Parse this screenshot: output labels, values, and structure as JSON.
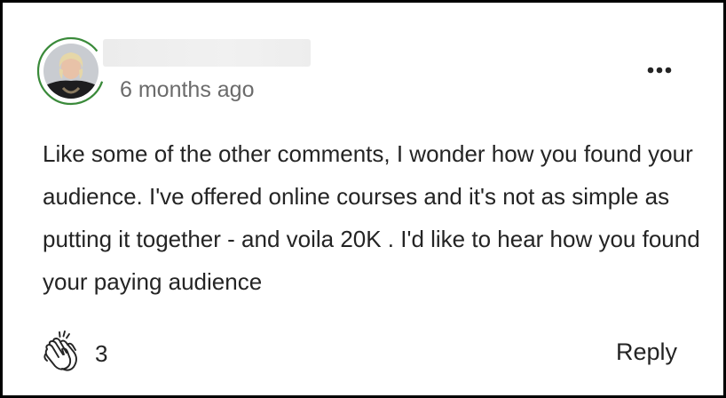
{
  "comment": {
    "author_name": "",
    "timestamp": "6 months ago",
    "body": "Like some of the other comments, I wonder how you found your audience. I've offered online courses and it's not as simple as putting it together - and voila 20K . I'd like to hear how you found your paying audience",
    "clap_count": "3",
    "reply_label": "Reply"
  },
  "icons": {
    "more": "more-horizontal-icon",
    "clap": "clap-icon",
    "avatar": "avatar-photo"
  },
  "colors": {
    "ring": "#3a8a3a",
    "text": "#242424",
    "muted": "#6b6b6b"
  }
}
